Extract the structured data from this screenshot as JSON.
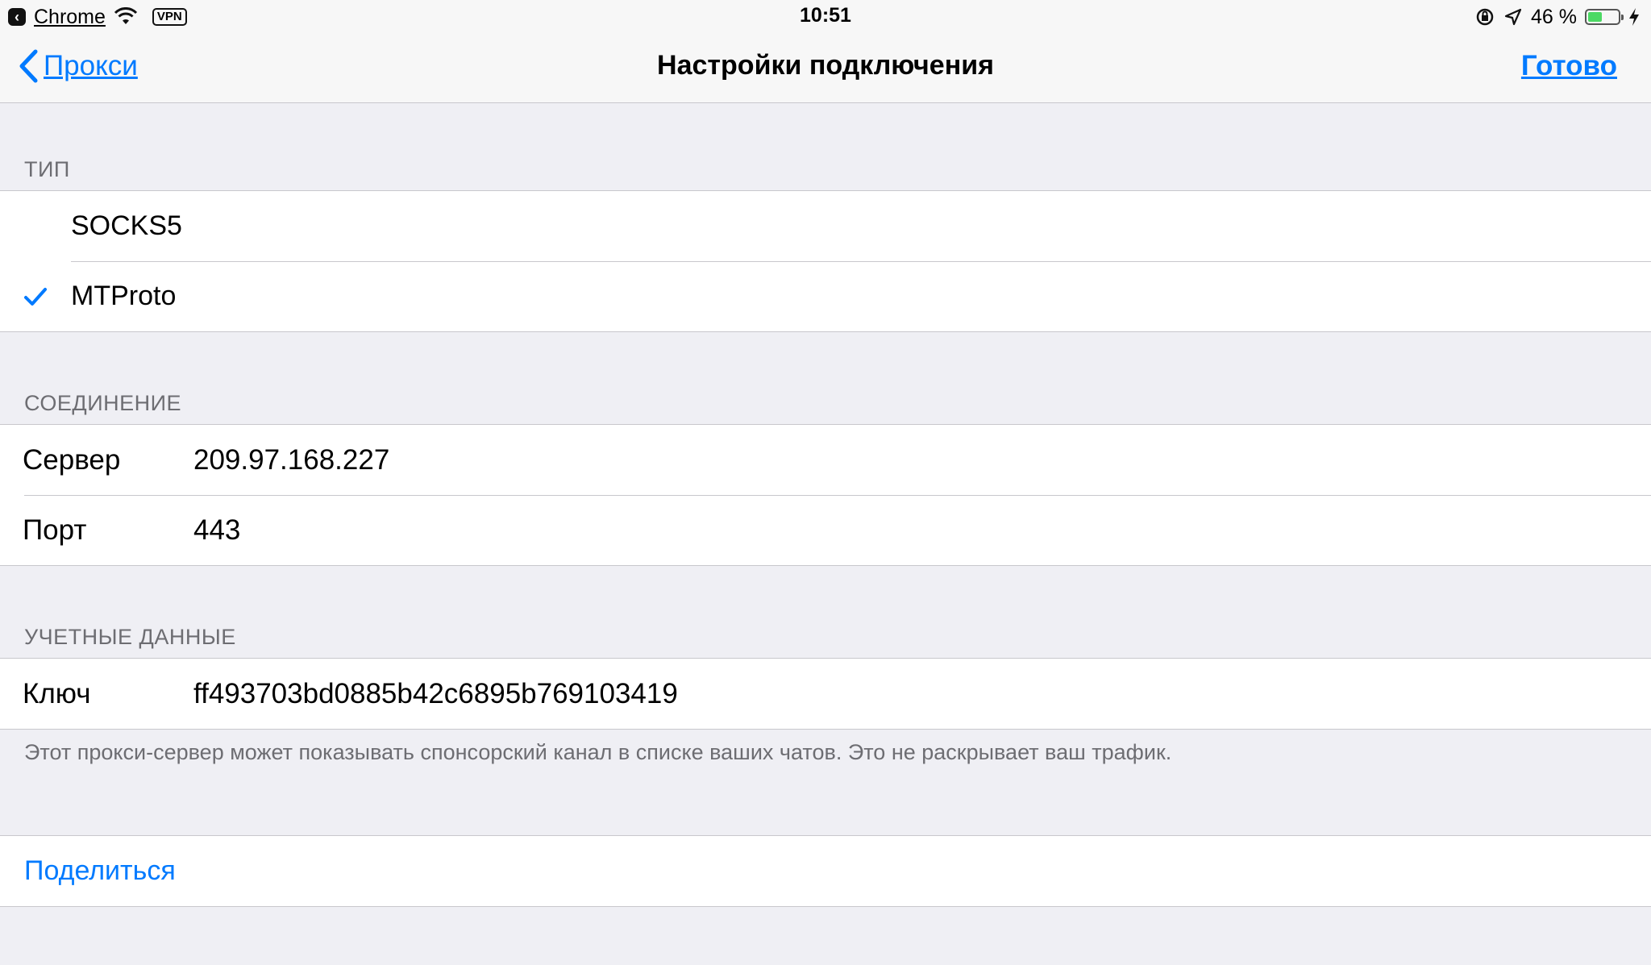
{
  "status_bar": {
    "app": "Chrome",
    "vpn": "VPN",
    "time": "10:51",
    "battery": "46 %",
    "battery_level": 0.46
  },
  "nav": {
    "back_label": "Прокси",
    "title": "Настройки подключения",
    "done_label": "Готово"
  },
  "type_section": {
    "header": "ТИП",
    "options": [
      "SOCKS5",
      "MTProto"
    ],
    "selected": "MTProto"
  },
  "connection_section": {
    "header": "СОЕДИНЕНИЕ",
    "server_label": "Сервер",
    "server_value": "209.97.168.227",
    "port_label": "Порт",
    "port_value": "443"
  },
  "credentials_section": {
    "header": "УЧЕТНЫЕ ДАННЫЕ",
    "key_label": "Ключ",
    "key_value": "ff493703bd0885b42c6895b769103419",
    "note": "Этот прокси-сервер может показывать спонсорский канал в списке ваших чатов. Это не раскрывает ваш трафик."
  },
  "share": {
    "label": "Поделиться"
  },
  "colors": {
    "accent": "#007aff",
    "background": "#efeff4",
    "battery_fill": "#4cd964"
  }
}
